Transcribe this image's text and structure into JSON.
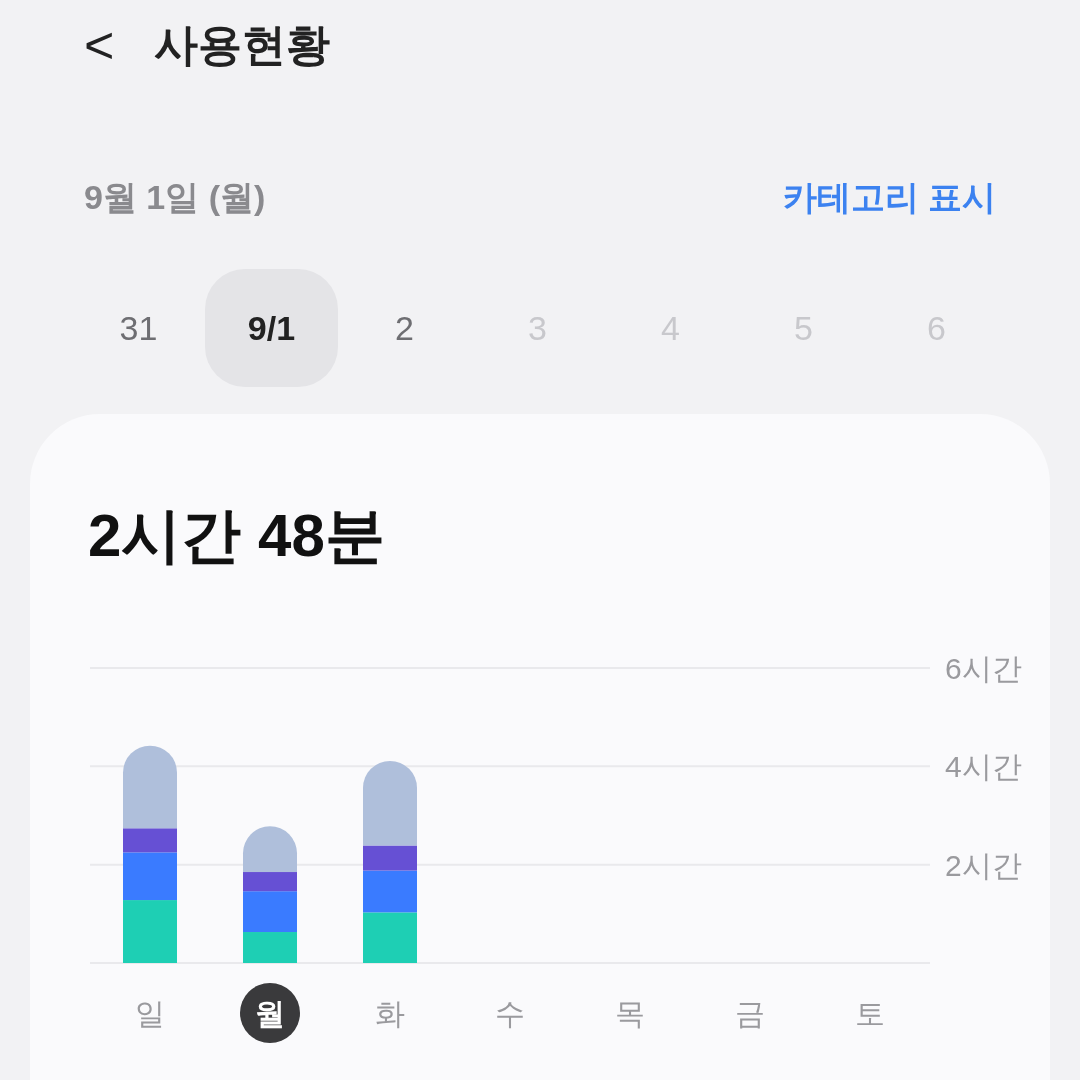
{
  "header": {
    "back": "<",
    "title": "사용현황"
  },
  "date_bar": {
    "date": "9월 1일 (월)",
    "category_toggle": "카테고리 표시"
  },
  "day_chips": [
    {
      "label": "31",
      "selected": false,
      "disabled": false
    },
    {
      "label": "9/1",
      "selected": true,
      "disabled": false
    },
    {
      "label": "2",
      "selected": false,
      "disabled": false
    },
    {
      "label": "3",
      "selected": false,
      "disabled": true
    },
    {
      "label": "4",
      "selected": false,
      "disabled": true
    },
    {
      "label": "5",
      "selected": false,
      "disabled": true
    },
    {
      "label": "6",
      "selected": false,
      "disabled": true
    }
  ],
  "usage_card": {
    "total": "2시간 48분",
    "chart_data": {
      "type": "bar",
      "stacked": true,
      "categories": [
        "일",
        "월",
        "화",
        "수",
        "목",
        "금",
        "토"
      ],
      "series": [
        {
          "color": "#1ecfb4",
          "values": [
            1.28,
            0.63,
            1.03,
            null,
            null,
            null,
            null
          ]
        },
        {
          "color": "#3a7bff",
          "values": [
            0.97,
            0.83,
            0.85,
            null,
            null,
            null,
            null
          ]
        },
        {
          "color": "#6650d4",
          "values": [
            0.49,
            0.39,
            0.51,
            null,
            null,
            null,
            null
          ]
        },
        {
          "color": "#afbfdb",
          "values": [
            1.68,
            0.93,
            1.72,
            null,
            null,
            null,
            null
          ]
        }
      ],
      "ylim": [
        0,
        6
      ],
      "yticks": [
        {
          "value": 2,
          "label": "2시간"
        },
        {
          "value": 4,
          "label": "4시간"
        },
        {
          "value": 6,
          "label": "6시간"
        }
      ]
    },
    "weekday_selected": [
      false,
      true,
      false,
      false,
      false,
      false,
      false
    ]
  }
}
